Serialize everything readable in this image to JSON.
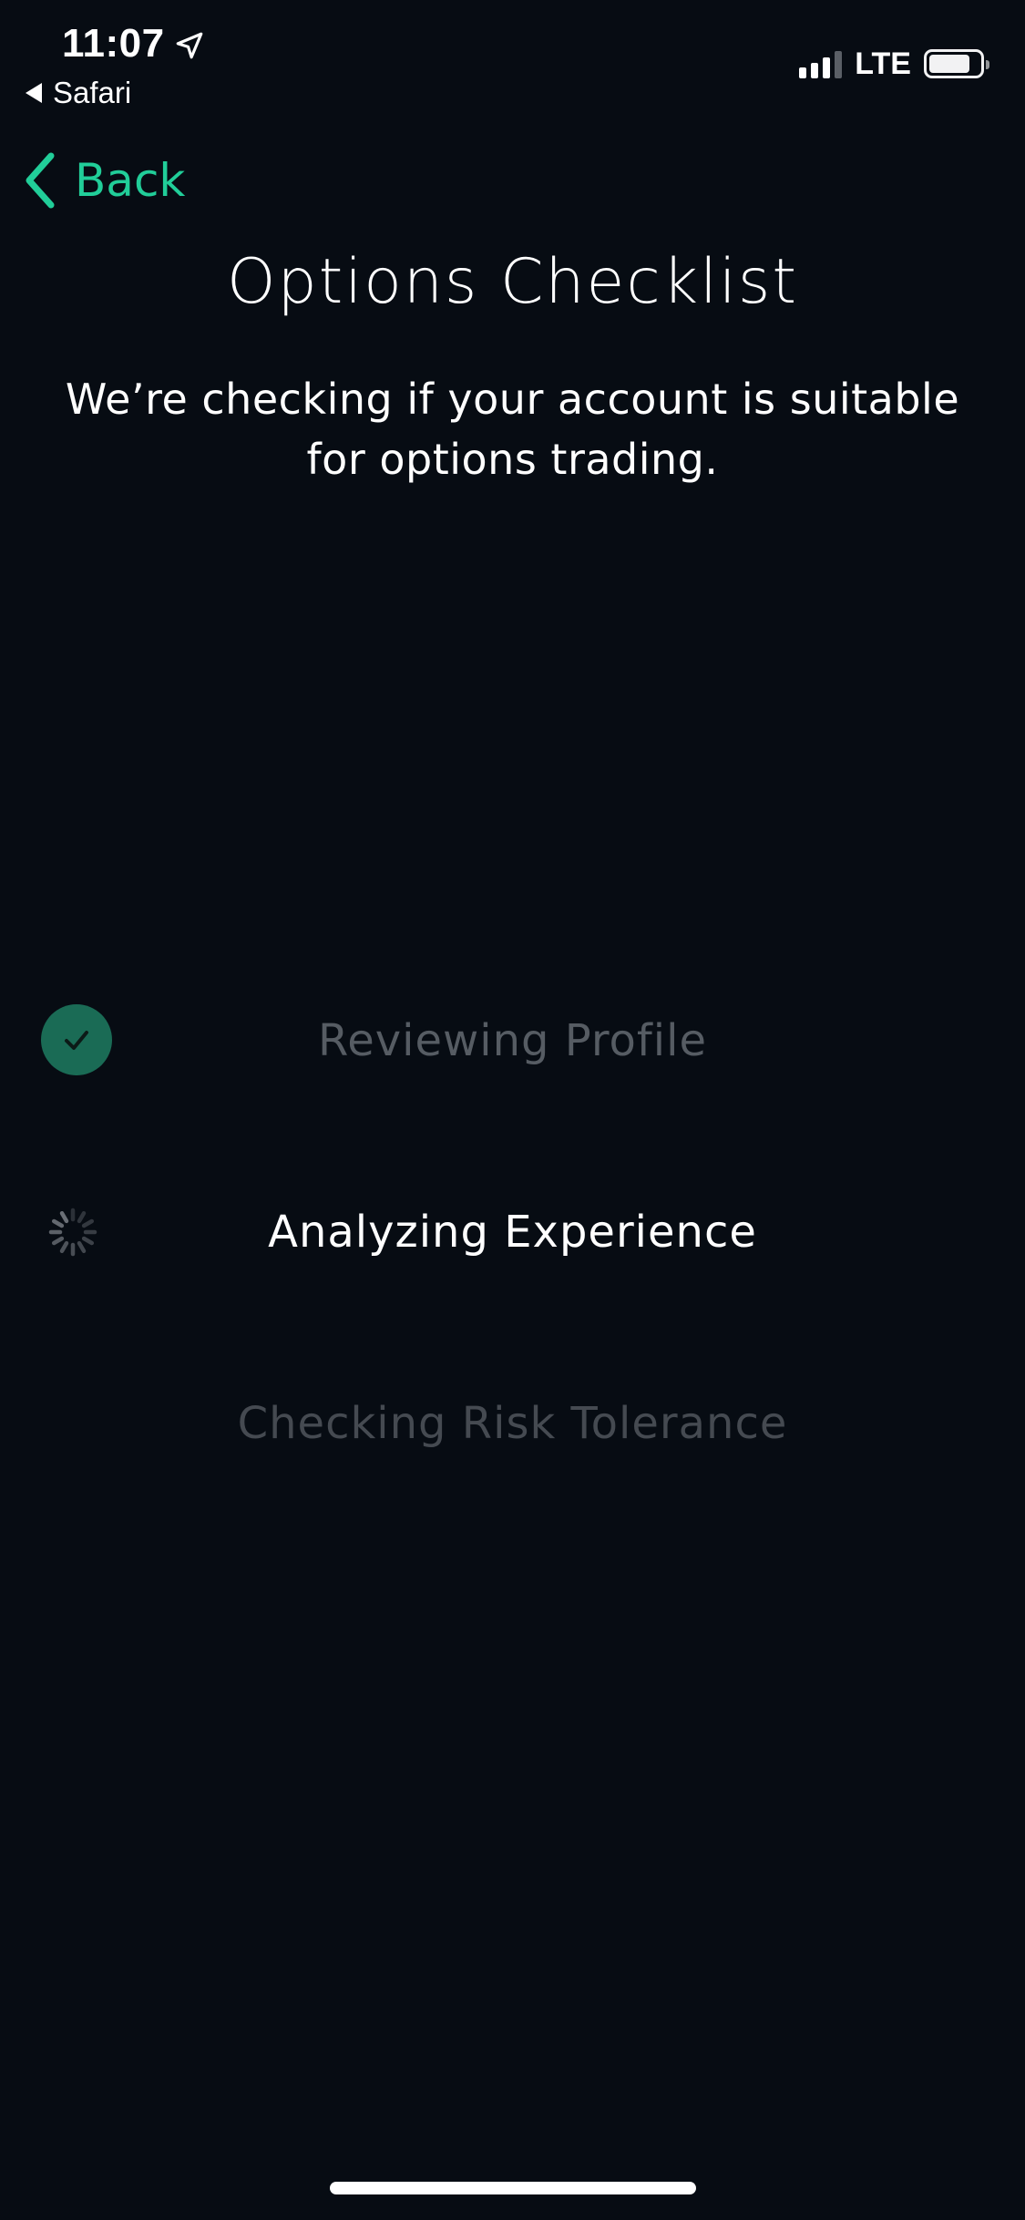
{
  "status_bar": {
    "time": "11:07",
    "back_app": "Safari",
    "network": "LTE",
    "icons": [
      "location-arrow-icon",
      "signal-icon",
      "battery-icon"
    ]
  },
  "nav": {
    "back_label": "Back",
    "accent_color": "#21CE99"
  },
  "header": {
    "title": "Options Checklist",
    "subtitle": "We’re checking if your account is suitable for options trading."
  },
  "checklist": {
    "items": [
      {
        "label": "Reviewing Profile",
        "status": "done",
        "icon": "checkmark-icon"
      },
      {
        "label": "Analyzing Experience",
        "status": "in-progress",
        "icon": "spinner-icon"
      },
      {
        "label": "Checking Risk Tolerance",
        "status": "pending",
        "icon": ""
      }
    ]
  },
  "colors": {
    "background": "#070C13",
    "accent": "#21CE99",
    "done_badge": "#1A6B55"
  }
}
